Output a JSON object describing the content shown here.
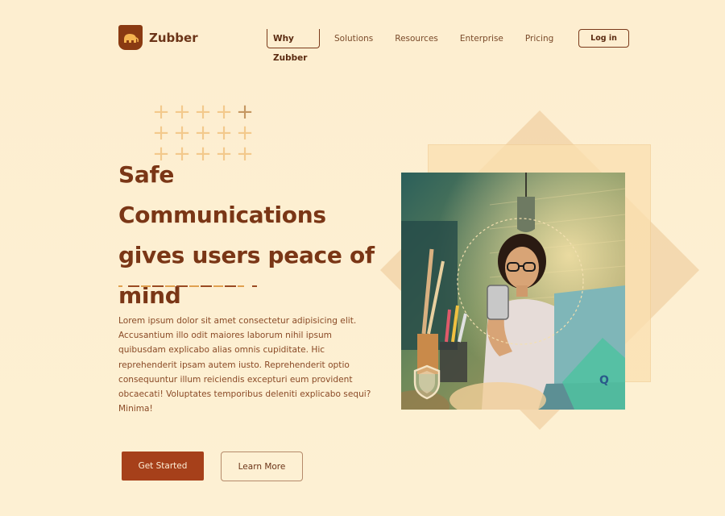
{
  "brand": {
    "name": "Zubber"
  },
  "nav": {
    "items": [
      "Why Zubber",
      "Solutions",
      "Resources",
      "Enterprise",
      "Pricing"
    ],
    "active": "Why Zubber"
  },
  "header": {
    "login_label": "Log in"
  },
  "hero": {
    "headline": "Safe Communications gives users peace of mind",
    "body": "Lorem ipsum dolor sit amet consectetur adipisicing elit. Accusantium illo odit maiores laborum nihil ipsum quibusdam explicabo alias omnis cupiditate. Hic reprehenderit ipsam autem iusto. Reprehenderit optio consequuntur illum reiciendis excepturi eum provident obcaecati! Voluptates temporibus deleniti explicabo sequi? Minima!",
    "primary_cta": "Get Started",
    "secondary_cta": "Learn More"
  },
  "colors": {
    "background": "#fdefd0",
    "brand_dark": "#7a3616",
    "cta": "#a6401a",
    "accent": "#e99a3a"
  },
  "icons": {
    "logo": "elephant-icon",
    "photo_badge": "shield-icon"
  }
}
